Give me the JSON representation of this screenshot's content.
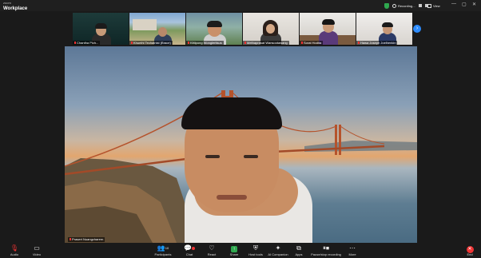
{
  "app": {
    "brand_small": "zoom",
    "brand_main": "Workplace"
  },
  "titlebar": {
    "recording_label": "Recording...",
    "view_label": "View",
    "window_controls": [
      "—",
      "▢",
      "✕"
    ]
  },
  "thumbnails": [
    {
      "name": "Chantha Pich..."
    },
    {
      "name": "Khunthi Techatnist (Brace)"
    },
    {
      "name": "Kittipong Wonglertisus"
    },
    {
      "name": "Methaprasat Wansootawang"
    },
    {
      "name": "Sorat Hodita"
    },
    {
      "name": "Hawa Joseph Joelhenkin"
    }
  ],
  "main_video": {
    "speaker_name": "Prasert Nuangcharern"
  },
  "toolbar": {
    "audio": "Audio",
    "video": "Video",
    "participants": "Participants",
    "participants_count": "10",
    "chat": "Chat",
    "react": "React",
    "share": "Share",
    "host_tools": "Host tools",
    "ai_companion": "AI Companion",
    "apps": "Apps",
    "pause_recording": "Pause/stop recording",
    "more": "More",
    "end": "End"
  },
  "colors": {
    "accent": "#2d8cff",
    "share_green": "#2fa84f",
    "end_red": "#e33333"
  },
  "icons": [
    "mic-muted-icon",
    "video-camera-icon",
    "participants-icon",
    "chat-icon",
    "react-icon",
    "share-icon",
    "shield-icon",
    "ai-companion-icon",
    "apps-icon",
    "pause-icon",
    "more-icon",
    "end-icon"
  ]
}
